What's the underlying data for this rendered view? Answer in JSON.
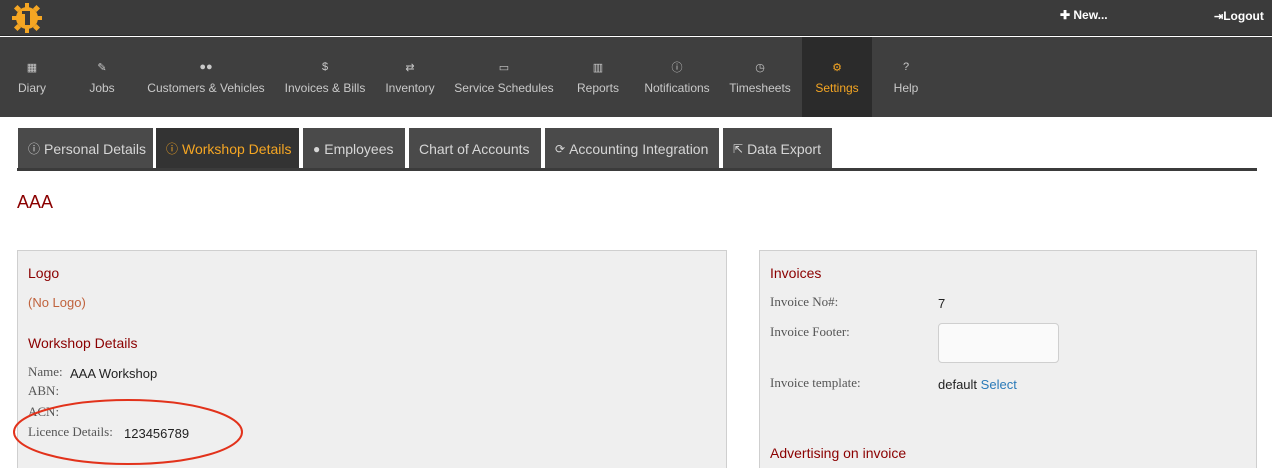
{
  "topbar": {
    "new_label": "✚ New...",
    "logout_label": "Logout"
  },
  "nav": [
    {
      "label": "Diary",
      "icon": "calendar-icon",
      "glyph": "▦"
    },
    {
      "label": "Jobs",
      "icon": "wrench-icon",
      "glyph": "🔧"
    },
    {
      "label": "Customers & Vehicles",
      "icon": "users-icon",
      "glyph": "👥"
    },
    {
      "label": "Invoices & Bills",
      "icon": "dollar-icon",
      "glyph": "$"
    },
    {
      "label": "Inventory",
      "icon": "exchange-icon",
      "glyph": "⇄"
    },
    {
      "label": "Service Schedules",
      "icon": "calendar-outline-icon",
      "glyph": "▭"
    },
    {
      "label": "Reports",
      "icon": "bar-chart-icon",
      "glyph": "▥"
    },
    {
      "label": "Notifications",
      "icon": "info-circle-icon",
      "glyph": "ⓘ"
    },
    {
      "label": "Timesheets",
      "icon": "clock-icon",
      "glyph": "◷"
    },
    {
      "label": "Settings",
      "icon": "cogs-icon",
      "glyph": "⚙"
    },
    {
      "label": "Help",
      "icon": "question-icon",
      "glyph": "?"
    }
  ],
  "tabs": [
    {
      "label": "Personal Details",
      "icon": "info-circle-icon",
      "glyph": "ⓘ"
    },
    {
      "label": "Workshop Details",
      "icon": "info-circle-icon",
      "glyph": "ⓘ"
    },
    {
      "label": "Employees",
      "icon": "user-icon",
      "glyph": "👤"
    },
    {
      "label": "Chart of Accounts",
      "icon": "",
      "glyph": ""
    },
    {
      "label": "Accounting Integration",
      "icon": "refresh-icon",
      "glyph": "⟳"
    },
    {
      "label": "Data Export",
      "icon": "share-icon",
      "glyph": "⇱"
    }
  ],
  "page": {
    "title": "AAA"
  },
  "left_panel": {
    "logo_heading": "Logo",
    "no_logo": "(No Logo)",
    "workshop_heading": "Workshop Details",
    "name_label": "Name:",
    "name_value": "AAA Workshop",
    "abn_label": "ABN:",
    "acn_label": "ACN:",
    "licence_label": "Licence Details:",
    "licence_value": "123456789"
  },
  "right_panel": {
    "invoices_heading": "Invoices",
    "invoice_no_label": "Invoice No#:",
    "invoice_no_value": "7",
    "invoice_footer_label": "Invoice Footer:",
    "invoice_template_label": "Invoice template:",
    "invoice_template_value": "default",
    "select_label": "Select",
    "advertising_heading": "Advertising on invoice"
  },
  "colors": {
    "accent": "#f5a623",
    "heading": "#8b0000",
    "annotation": "#e2321b"
  }
}
